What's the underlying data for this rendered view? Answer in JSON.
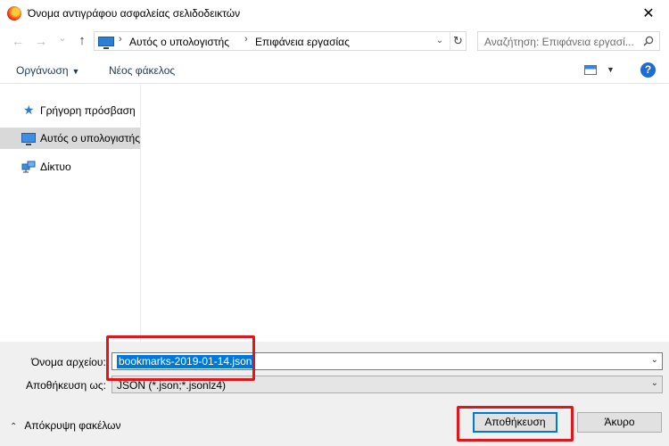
{
  "window": {
    "title": "Όνομα αντιγράφου ασφαλείας σελιδοδεικτών",
    "close_glyph": "✕"
  },
  "nav": {
    "back_glyph": "←",
    "forward_glyph": "→",
    "recent_glyph": "⌄",
    "up_glyph": "↑"
  },
  "address": {
    "segments": [
      "Αυτός ο υπολογιστής",
      "Επιφάνεια εργασίας"
    ],
    "separator": "›",
    "dropdown_glyph": "⌄",
    "refresh_glyph": "↻"
  },
  "search": {
    "placeholder": "Αναζήτηση: Επιφάνεια εργασί..."
  },
  "toolbar": {
    "organize_label": "Οργάνωση",
    "organize_caret": "▼",
    "new_folder_label": "Νέος φάκελος",
    "view_caret": "▼",
    "help_glyph": "?"
  },
  "sidebar": {
    "items": [
      {
        "label": "Γρήγορη πρόσβαση",
        "icon": "star-icon",
        "selected": false
      },
      {
        "label": "Αυτός ο υπολογιστής",
        "icon": "computer-icon",
        "selected": true
      },
      {
        "label": "Δίκτυο",
        "icon": "network-icon",
        "selected": false
      }
    ]
  },
  "form": {
    "filename_label": "Όνομα αρχείου:",
    "filename_value": "bookmarks-2019-01-14.json",
    "savetype_label": "Αποθήκευση ως:",
    "savetype_value": "JSON (*.json;*.jsonlz4)",
    "dropdown_glyph": "⌄"
  },
  "footer": {
    "hide_folders_label": "Απόκρυψη φακέλων",
    "hide_caret": "⌃",
    "save_label": "Αποθήκευση",
    "cancel_label": "Άκυρο"
  },
  "colors": {
    "highlight": "#e0161b",
    "selection": "#0078d7",
    "accent": "#1e6ad6"
  }
}
